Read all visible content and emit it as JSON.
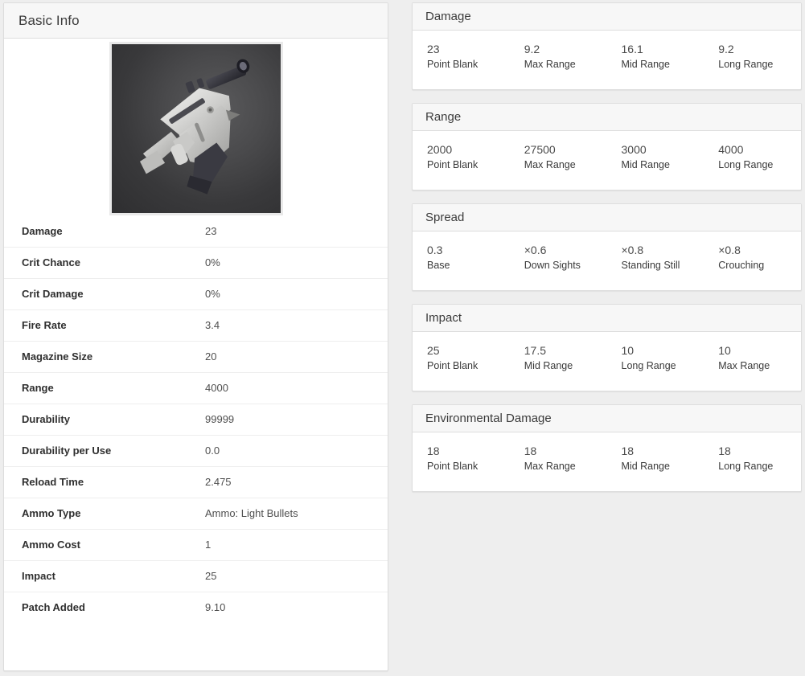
{
  "basic_info": {
    "header": "Basic Info",
    "image_alt": "weapon-render",
    "rows": [
      {
        "label": "Damage",
        "value": "23"
      },
      {
        "label": "Crit Chance",
        "value": "0%"
      },
      {
        "label": "Crit Damage",
        "value": "0%"
      },
      {
        "label": "Fire Rate",
        "value": "3.4"
      },
      {
        "label": "Magazine Size",
        "value": "20"
      },
      {
        "label": "Range",
        "value": "4000"
      },
      {
        "label": "Durability",
        "value": "99999"
      },
      {
        "label": "Durability per Use",
        "value": "0.0"
      },
      {
        "label": "Reload Time",
        "value": "2.475"
      },
      {
        "label": "Ammo Type",
        "value": "Ammo: Light Bullets"
      },
      {
        "label": "Ammo Cost",
        "value": "1"
      },
      {
        "label": "Impact",
        "value": "25"
      },
      {
        "label": "Patch Added",
        "value": "9.10"
      }
    ]
  },
  "cards": [
    {
      "title": "Damage",
      "cells": [
        {
          "value": "23",
          "label": "Point Blank"
        },
        {
          "value": "9.2",
          "label": "Max Range"
        },
        {
          "value": "16.1",
          "label": "Mid Range"
        },
        {
          "value": "9.2",
          "label": "Long Range"
        }
      ]
    },
    {
      "title": "Range",
      "cells": [
        {
          "value": "2000",
          "label": "Point Blank"
        },
        {
          "value": "27500",
          "label": "Max Range"
        },
        {
          "value": "3000",
          "label": "Mid Range"
        },
        {
          "value": "4000",
          "label": "Long Range"
        }
      ]
    },
    {
      "title": "Spread",
      "cells": [
        {
          "value": "0.3",
          "label": "Base"
        },
        {
          "value": "×0.6",
          "label": "Down Sights"
        },
        {
          "value": "×0.8",
          "label": "Standing Still"
        },
        {
          "value": "×0.8",
          "label": "Crouching"
        }
      ]
    },
    {
      "title": "Impact",
      "cells": [
        {
          "value": "25",
          "label": "Point Blank"
        },
        {
          "value": "17.5",
          "label": "Mid Range"
        },
        {
          "value": "10",
          "label": "Long Range"
        },
        {
          "value": "10",
          "label": "Max Range"
        }
      ]
    },
    {
      "title": "Environmental Damage",
      "cells": [
        {
          "value": "18",
          "label": "Point Blank"
        },
        {
          "value": "18",
          "label": "Max Range"
        },
        {
          "value": "18",
          "label": "Mid Range"
        },
        {
          "value": "18",
          "label": "Long Range"
        }
      ]
    }
  ],
  "colors": {
    "page_background": "#eeeeee",
    "panel_background": "#ffffff",
    "header_background": "#f7f7f7",
    "border": "#dddddd",
    "label_text": "#2f2f2f",
    "value_text": "#4f4f4f"
  }
}
